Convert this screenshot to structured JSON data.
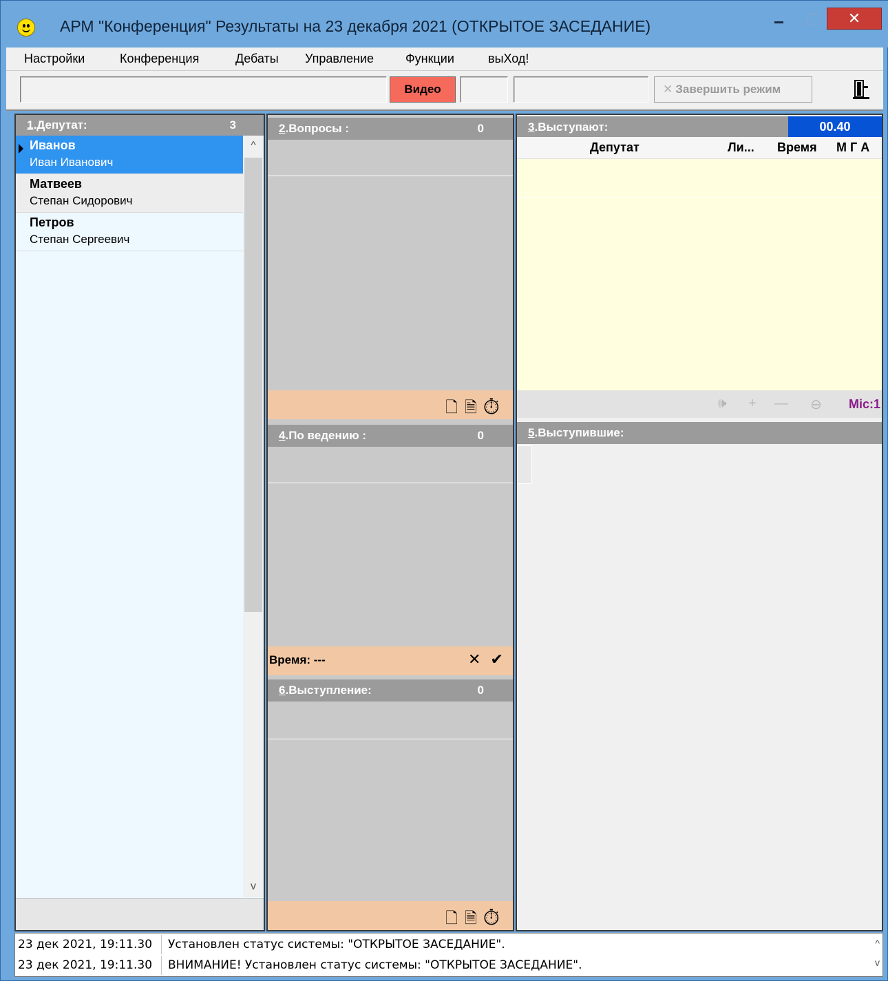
{
  "window": {
    "title": "АРМ \"Конференция\" Результаты на 23 декабря 2021  (ОТКРЫТОЕ ЗАСЕДАНИЕ)",
    "close_glyph": "✕"
  },
  "menu": {
    "items": [
      {
        "label": "Настройки"
      },
      {
        "label": "Конференция"
      },
      {
        "label": "Дебаты"
      },
      {
        "label": "Управление"
      },
      {
        "label": "Функции"
      },
      {
        "label": "выХод!"
      }
    ]
  },
  "toolbar": {
    "video_label": "Видео",
    "finish_label": "Завершить режим",
    "finish_glyph": "✕"
  },
  "panel1": {
    "num": "1",
    "title": ".Депутат:",
    "count": "3",
    "deputies": [
      {
        "surname": "Иванов",
        "given": "Иван Иванович"
      },
      {
        "surname": "Матвеев",
        "given": "Степан Сидорович"
      },
      {
        "surname": "Петров",
        "given": "Степан Сергеевич"
      }
    ],
    "scroll_up": "^",
    "scroll_down": "v"
  },
  "panel2": {
    "num": "2",
    "title": ".Вопросы :",
    "count": "0"
  },
  "panel4": {
    "num": "4",
    "title": ".По ведению :",
    "count": "0"
  },
  "panel6": {
    "num": "6",
    "title": ".Выступление:",
    "count": "0"
  },
  "time_bar": {
    "label": "Время: ---",
    "icons": "✕ ✔"
  },
  "panel3": {
    "num": "3",
    "title": ".Выступают:",
    "timer": "00.40",
    "columns": {
      "deputy": "Депутат",
      "list": "Ли...",
      "time": "Время",
      "mga": "М Г А"
    },
    "mic_label": "Mic:1"
  },
  "panel5": {
    "num": "5",
    "title": ".Выступившие:"
  },
  "log": [
    {
      "timestamp": "23 дек 2021, 19:11.30",
      "message": "Установлен статус системы: \"ОТКРЫТОЕ ЗАСЕДАНИЕ\"."
    },
    {
      "timestamp": "23 дек 2021, 19:11.30",
      "message": "ВНИМАНИЕ! Установлен статус системы: \"ОТКРЫТОЕ ЗАСЕДАНИЕ\"."
    }
  ],
  "icons": {
    "app": "smiley-icon",
    "panel_tools": [
      "new-document-icon",
      "document-icon",
      "stopwatch-icon"
    ],
    "exit": "door-exit-icon"
  },
  "colors": {
    "selection": "#2f93f0",
    "video_button": "#f66a5c",
    "timer_bg": "#0753d6",
    "peach_bar": "#f2c8a4",
    "speakers_bg": "#ffffe0",
    "mic_text": "#8a1c8a"
  }
}
